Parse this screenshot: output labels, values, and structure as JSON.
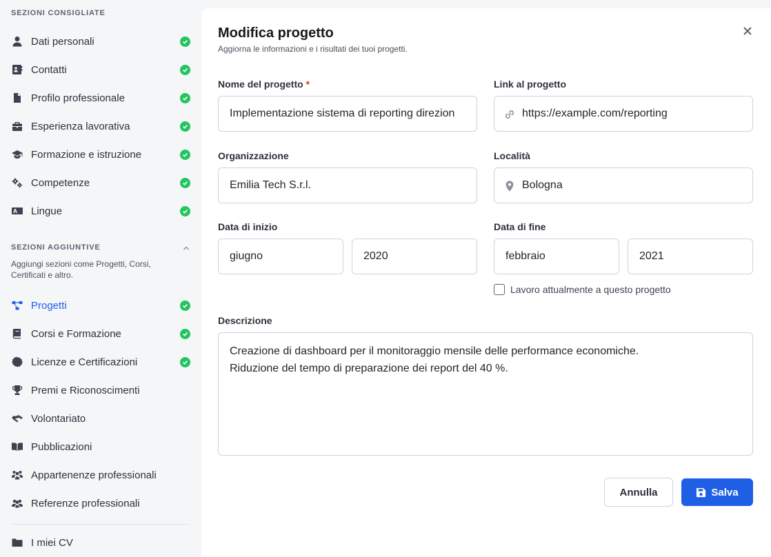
{
  "colors": {
    "accent": "#1f5fe6",
    "check_green": "#22c55e",
    "required_red": "#e03131"
  },
  "sidebar": {
    "recommended_title": "SEZIONI CONSIGLIATE",
    "recommended_items": [
      {
        "label": "Dati personali",
        "icon": "user-icon",
        "completed": true
      },
      {
        "label": "Contatti",
        "icon": "contact-card-icon",
        "completed": true
      },
      {
        "label": "Profilo professionale",
        "icon": "document-icon",
        "completed": true
      },
      {
        "label": "Esperienza lavorativa",
        "icon": "briefcase-icon",
        "completed": true
      },
      {
        "label": "Formazione e istruzione",
        "icon": "graduation-cap-icon",
        "completed": true
      },
      {
        "label": "Competenze",
        "icon": "gears-icon",
        "completed": true
      },
      {
        "label": "Lingue",
        "icon": "language-icon",
        "completed": true
      }
    ],
    "additional_title": "SEZIONI AGGIUNTIVE",
    "additional_description": "Aggiungi sezioni come Progetti, Corsi, Certificati e altro.",
    "additional_items": [
      {
        "label": "Progetti",
        "icon": "project-diagram-icon",
        "completed": true,
        "active": true
      },
      {
        "label": "Corsi e Formazione",
        "icon": "book-icon",
        "completed": true
      },
      {
        "label": "Licenze e Certificazioni",
        "icon": "certificate-icon",
        "completed": true
      },
      {
        "label": "Premi e Riconoscimenti",
        "icon": "trophy-icon",
        "completed": false
      },
      {
        "label": "Volontariato",
        "icon": "handshake-icon",
        "completed": false
      },
      {
        "label": "Pubblicazioni",
        "icon": "open-book-icon",
        "completed": false
      },
      {
        "label": "Appartenenze professionali",
        "icon": "people-group-icon",
        "completed": false
      },
      {
        "label": "Referenze professionali",
        "icon": "users-icon",
        "completed": false
      }
    ],
    "my_cvs": {
      "label": "I miei CV",
      "icon": "folder-icon"
    }
  },
  "panel": {
    "title": "Modifica progetto",
    "subtitle": "Aggiorna le informazioni e i risultati dei tuoi progetti.",
    "fields": {
      "project_name": {
        "label": "Nome del progetto",
        "required_mark": "*",
        "value": "Implementazione sistema di reporting direzion"
      },
      "project_link": {
        "label": "Link al progetto",
        "value": "https://example.com/reporting",
        "icon": "link-icon"
      },
      "organization": {
        "label": "Organizzazione",
        "value": "Emilia Tech S.r.l."
      },
      "location": {
        "label": "Località",
        "value": "Bologna",
        "icon": "map-pin-icon"
      },
      "start_date": {
        "label": "Data di inizio",
        "month": "giugno",
        "year": "2020"
      },
      "end_date": {
        "label": "Data di fine",
        "month": "febbraio",
        "year": "2021"
      },
      "current_checkbox": {
        "label": "Lavoro attualmente a questo progetto",
        "checked": false
      },
      "description": {
        "label": "Descrizione",
        "lines": [
          "Creazione di dashboard per il monitoraggio mensile delle performance economiche.",
          "Riduzione del tempo di preparazione dei report del 40 %."
        ]
      }
    },
    "buttons": {
      "cancel": "Annulla",
      "save": "Salva"
    }
  }
}
